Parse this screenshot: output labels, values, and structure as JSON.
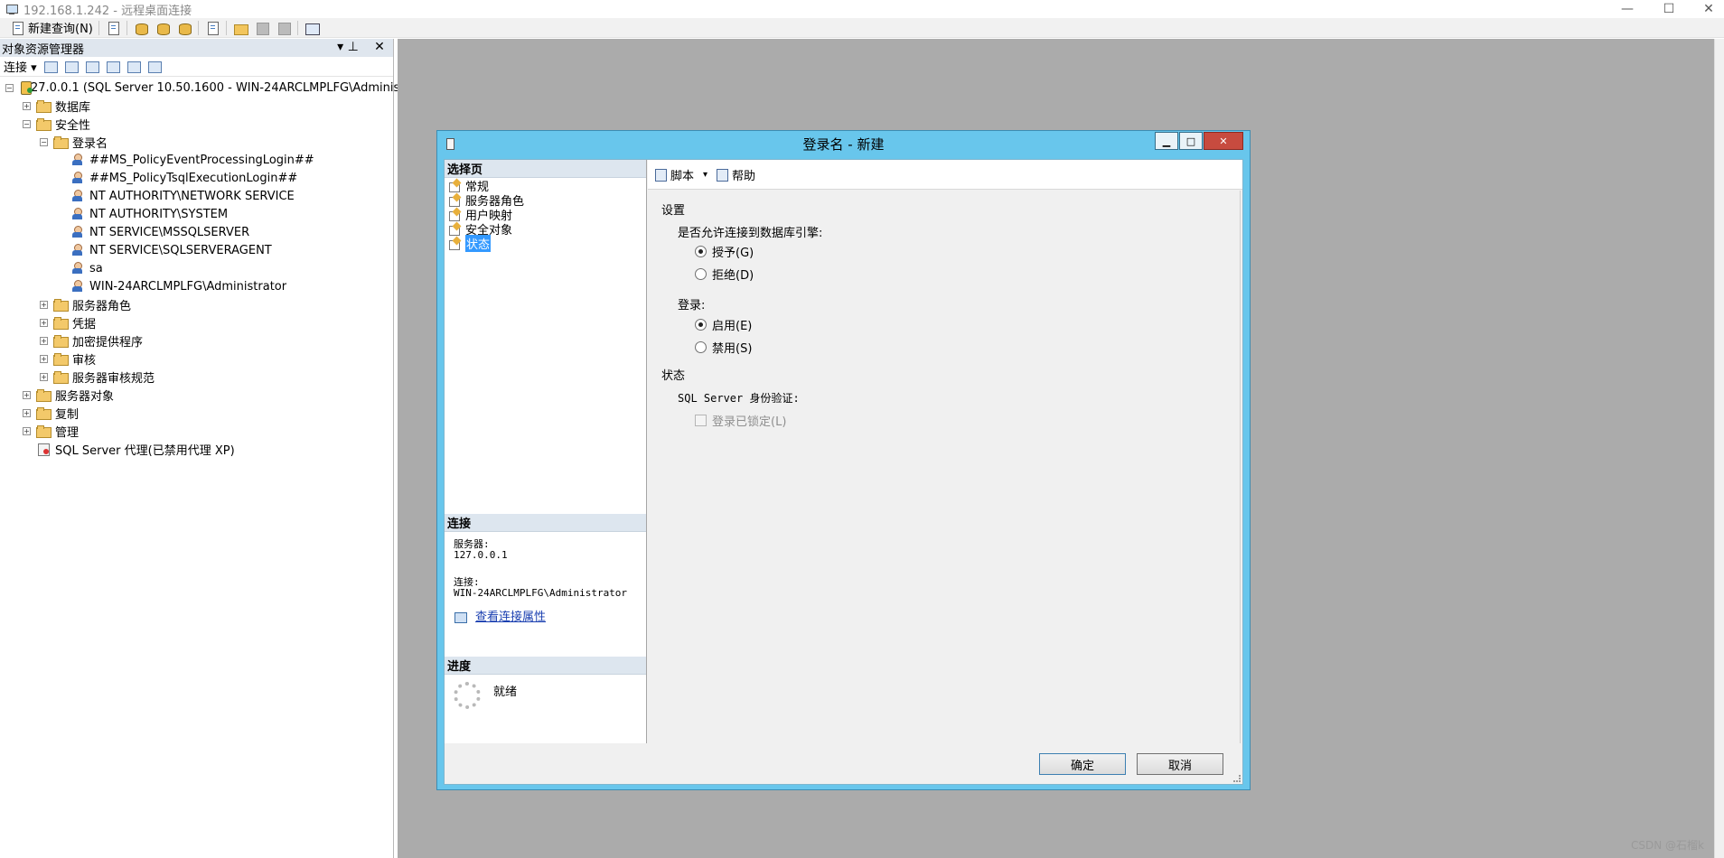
{
  "window": {
    "title": "192.168.1.242 - 远程桌面连接",
    "controls": [
      "—",
      "☐",
      "✕"
    ]
  },
  "toolbar": {
    "new_query_label": "新建查询(N)"
  },
  "object_explorer": {
    "title": "对象资源管理器",
    "pin_glyph": "▾ ⊥",
    "close_glyph": "✕",
    "connect_label": "连接 ▾",
    "tree": [
      {
        "label": "127.0.0.1 (SQL Server 10.50.1600 - WIN-24ARCLMPLFG\\Administrator)",
        "icon": "server",
        "level": 0,
        "expander": "−"
      },
      {
        "label": "数据库",
        "icon": "folder",
        "level": 1,
        "expander": "+"
      },
      {
        "label": "安全性",
        "icon": "folder",
        "level": 1,
        "expander": "−"
      },
      {
        "label": "登录名",
        "icon": "folder",
        "level": 2,
        "expander": "−"
      },
      {
        "label": "##MS_PolicyEventProcessingLogin##",
        "icon": "user",
        "level": 3,
        "expander": ""
      },
      {
        "label": "##MS_PolicyTsqlExecutionLogin##",
        "icon": "user",
        "level": 3,
        "expander": ""
      },
      {
        "label": "NT AUTHORITY\\NETWORK SERVICE",
        "icon": "user",
        "level": 3,
        "expander": ""
      },
      {
        "label": "NT AUTHORITY\\SYSTEM",
        "icon": "user",
        "level": 3,
        "expander": ""
      },
      {
        "label": "NT SERVICE\\MSSQLSERVER",
        "icon": "user",
        "level": 3,
        "expander": ""
      },
      {
        "label": "NT SERVICE\\SQLSERVERAGENT",
        "icon": "user",
        "level": 3,
        "expander": ""
      },
      {
        "label": "sa",
        "icon": "user",
        "level": 3,
        "expander": ""
      },
      {
        "label": "WIN-24ARCLMPLFG\\Administrator",
        "icon": "user",
        "level": 3,
        "expander": ""
      },
      {
        "label": "服务器角色",
        "icon": "folder",
        "level": 2,
        "expander": "+"
      },
      {
        "label": "凭据",
        "icon": "folder",
        "level": 2,
        "expander": "+"
      },
      {
        "label": "加密提供程序",
        "icon": "folder",
        "level": 2,
        "expander": "+"
      },
      {
        "label": "审核",
        "icon": "folder",
        "level": 2,
        "expander": "+"
      },
      {
        "label": "服务器审核规范",
        "icon": "folder",
        "level": 2,
        "expander": "+"
      },
      {
        "label": "服务器对象",
        "icon": "folder",
        "level": 1,
        "expander": "+"
      },
      {
        "label": "复制",
        "icon": "folder",
        "level": 1,
        "expander": "+"
      },
      {
        "label": "管理",
        "icon": "folder",
        "level": 1,
        "expander": "+"
      },
      {
        "label": "SQL Server 代理(已禁用代理 XP)",
        "icon": "agent",
        "level": 1,
        "expander": ""
      }
    ]
  },
  "dialog": {
    "title": "登录名 - 新建",
    "win_min": "▁",
    "win_max": "□",
    "win_close": "✕",
    "select_page_header": "选择页",
    "pages": [
      {
        "label": "常规",
        "selected": false
      },
      {
        "label": "服务器角色",
        "selected": false
      },
      {
        "label": "用户映射",
        "selected": false
      },
      {
        "label": "安全对象",
        "selected": false
      },
      {
        "label": "状态",
        "selected": true
      }
    ],
    "connection_header": "连接",
    "server_label": "服务器:",
    "server_value": "127.0.0.1",
    "connection_label": "连接:",
    "connection_value": "WIN-24ARCLMPLFG\\Administrator",
    "view_props_link": "查看连接属性",
    "progress_header": "进度",
    "progress_status": "就绪",
    "script_label": "脚本",
    "script_dropdown": "▾",
    "help_label": "帮助",
    "settings_title": "设置",
    "permission_question": "是否允许连接到数据库引擎:",
    "grant_label": "授予(G)",
    "deny_label": "拒绝(D)",
    "grant_selected": true,
    "login_group": "登录:",
    "enable_label": "启用(E)",
    "disable_label": "禁用(S)",
    "enable_selected": true,
    "status_title": "状态",
    "sql_auth_label": "SQL Server 身份验证:",
    "locked_label": "登录已锁定(L)",
    "ok_label": "确定",
    "cancel_label": "取消"
  },
  "watermark": "CSDN @石榴k"
}
